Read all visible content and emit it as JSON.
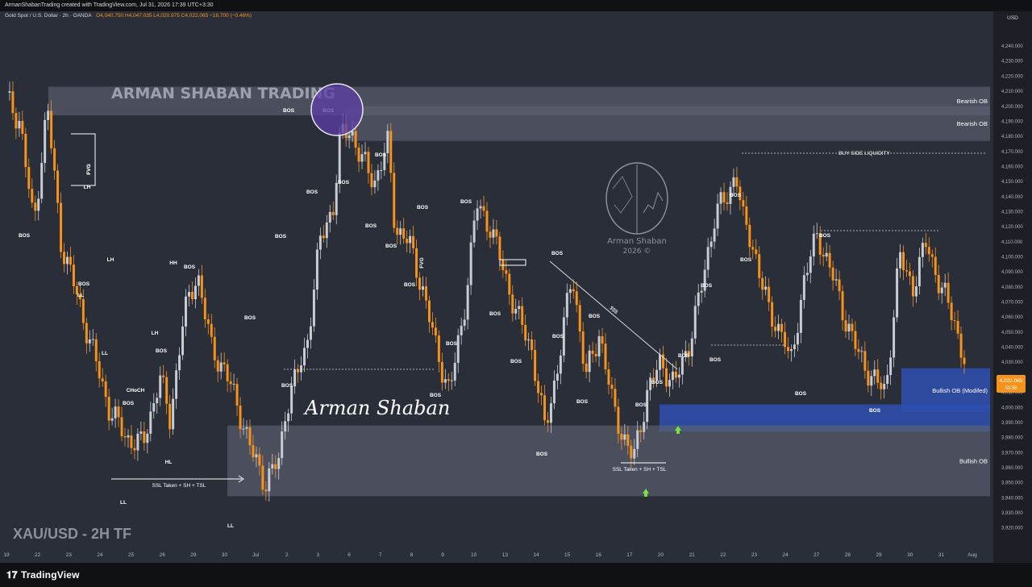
{
  "header": {
    "credit": "ArmanShabanTrading created with TradingView.com, Jul 31, 2026 17:39 UTC+3:30",
    "symbol": "Gold Spot / U.S. Dollar · 2h · OANDA",
    "ohlc": "O4,040.750  H4,047.035  L4,020.975  C4,022.065  −18.700 (−0.46%)"
  },
  "watermark": {
    "brand": "ARMAN SHABAN TRADING",
    "signature": "Arman Shaban",
    "logo_text": "Arman Shaban",
    "logo_year": "2026 ©"
  },
  "corner_label": "XAU/USD - 2H TF",
  "footer_brand": "TradingView",
  "colors": {
    "bull": "#c9ccd3",
    "bear": "#f7931a",
    "background": "#2a2e39",
    "accent_blue": "#2962ff",
    "green_arrow": "#76e33b"
  },
  "chart_data": {
    "type": "candlestick",
    "currency": "USD",
    "y_ticks": [
      3920,
      3930,
      3940,
      3950,
      3960,
      3970,
      3980,
      3990,
      4000,
      4010,
      4020,
      4030,
      4040,
      4050,
      4060,
      4070,
      4080,
      4090,
      4100,
      4110,
      4120,
      4130,
      4140,
      4150,
      4160,
      4170,
      4180,
      4190,
      4200,
      4210,
      4220,
      4230,
      4240
    ],
    "ylim": [
      3915,
      4247
    ],
    "x_ticks": [
      "19",
      "22",
      "23",
      "24",
      "25",
      "26",
      "29",
      "30",
      "Jul",
      "2",
      "3",
      "6",
      "7",
      "8",
      "9",
      "10",
      "13",
      "14",
      "15",
      "16",
      "17",
      "20",
      "21",
      "22",
      "23",
      "24",
      "27",
      "28",
      "29",
      "30",
      "31",
      "Aug"
    ],
    "last_price": "4,022.065",
    "countdown": "50:56",
    "close_path": [
      [
        0,
        4205
      ],
      [
        4,
        4190
      ],
      [
        8,
        4120
      ],
      [
        12,
        4200
      ],
      [
        16,
        4110
      ],
      [
        20,
        4080
      ],
      [
        25,
        4040
      ],
      [
        30,
        4000
      ],
      [
        35,
        3980
      ],
      [
        40,
        3975
      ],
      [
        45,
        4020
      ],
      [
        48,
        3992
      ],
      [
        52,
        4060
      ],
      [
        56,
        4090
      ],
      [
        60,
        4040
      ],
      [
        64,
        4025
      ],
      [
        68,
        4000
      ],
      [
        72,
        3970
      ],
      [
        76,
        3950
      ],
      [
        80,
        3965
      ],
      [
        82,
        4000
      ],
      [
        85,
        4020
      ],
      [
        88,
        4040
      ],
      [
        92,
        4110
      ],
      [
        96,
        4135
      ],
      [
        98,
        4180
      ],
      [
        101,
        4185
      ],
      [
        104,
        4165
      ],
      [
        108,
        4150
      ],
      [
        112,
        4175
      ],
      [
        114,
        4120
      ],
      [
        118,
        4110
      ],
      [
        122,
        4080
      ],
      [
        126,
        4040
      ],
      [
        130,
        4010
      ],
      [
        134,
        4060
      ],
      [
        138,
        4135
      ],
      [
        142,
        4120
      ],
      [
        146,
        4090
      ],
      [
        150,
        4060
      ],
      [
        154,
        4040
      ],
      [
        158,
        3985
      ],
      [
        162,
        4030
      ],
      [
        166,
        4090
      ],
      [
        170,
        4020
      ],
      [
        174,
        4050
      ],
      [
        178,
        4000
      ],
      [
        182,
        3975
      ],
      [
        184,
        3965
      ],
      [
        188,
        4010
      ],
      [
        192,
        4030
      ],
      [
        196,
        4015
      ],
      [
        200,
        4040
      ],
      [
        204,
        4080
      ],
      [
        208,
        4130
      ],
      [
        212,
        4140
      ],
      [
        214,
        4160
      ],
      [
        216,
        4125
      ],
      [
        220,
        4100
      ],
      [
        224,
        4060
      ],
      [
        228,
        4050
      ],
      [
        230,
        4025
      ],
      [
        234,
        4085
      ],
      [
        238,
        4115
      ],
      [
        242,
        4090
      ],
      [
        246,
        4060
      ],
      [
        250,
        4035
      ],
      [
        254,
        4020
      ],
      [
        258,
        4010
      ],
      [
        262,
        4100
      ],
      [
        266,
        4080
      ],
      [
        270,
        4110
      ],
      [
        274,
        4080
      ],
      [
        278,
        4060
      ],
      [
        280,
        4040
      ],
      [
        282,
        4022
      ]
    ],
    "zones": [
      {
        "label": "Bearish OB",
        "from": 4194,
        "to": 4213,
        "color": "gray"
      },
      {
        "label": "Bearish OB",
        "from": 4177,
        "to": 4200,
        "color": "gray"
      },
      {
        "label": "Bullish OB (Modifed)",
        "from": 3997,
        "to": 4026,
        "color": "blue"
      },
      {
        "label": "",
        "from": 3984,
        "to": 4002,
        "color": "blue"
      },
      {
        "label": "Bullish OB",
        "from": 3941,
        "to": 3988,
        "color": "gray"
      }
    ],
    "annotations": [
      {
        "text": "BUY SIDE LIQUIDITY",
        "price": 4166
      },
      {
        "text": "SSL Taken + SH + TSL",
        "price": 3962
      },
      {
        "text": "SSL Taken + SH + TSL",
        "price": 3966
      },
      {
        "text": "$$$",
        "price": 4070
      },
      {
        "text": "BOS"
      },
      {
        "text": "LH"
      },
      {
        "text": "LL"
      },
      {
        "text": "HH"
      },
      {
        "text": "HL"
      },
      {
        "text": "CHoCH"
      },
      {
        "text": "FVG"
      }
    ],
    "structure_labels": [
      {
        "t": "BOS",
        "x": 30,
        "y": 280
      },
      {
        "t": "LL",
        "x": 100,
        "y": 354
      },
      {
        "t": "BOS",
        "x": 104,
        "y": 340
      },
      {
        "t": "LH",
        "x": 108,
        "y": 220
      },
      {
        "t": "FVG",
        "x": 112,
        "y": 196
      },
      {
        "t": "LH",
        "x": 137,
        "y": 310
      },
      {
        "t": "LL",
        "x": 130,
        "y": 426
      },
      {
        "t": "LH",
        "x": 192,
        "y": 401
      },
      {
        "t": "BOS",
        "x": 200,
        "y": 423
      },
      {
        "t": "CHoCH",
        "x": 168,
        "y": 472
      },
      {
        "t": "BOS",
        "x": 159,
        "y": 488
      },
      {
        "t": "HH",
        "x": 215,
        "y": 314
      },
      {
        "t": "BOS",
        "x": 235,
        "y": 319
      },
      {
        "t": "HL",
        "x": 209,
        "y": 561
      },
      {
        "t": "LL",
        "x": 153,
        "y": 611
      },
      {
        "t": "LL",
        "x": 286,
        "y": 640
      },
      {
        "t": "BOS",
        "x": 310,
        "y": 382
      },
      {
        "t": "BOS",
        "x": 356,
        "y": 466
      },
      {
        "t": "BOS",
        "x": 348,
        "y": 281
      },
      {
        "t": "BOS",
        "x": 387,
        "y": 226
      },
      {
        "t": "BOS",
        "x": 407,
        "y": 125
      },
      {
        "t": "BOS",
        "x": 358,
        "y": 125
      },
      {
        "t": "BOS",
        "x": 426,
        "y": 214
      },
      {
        "t": "BOS",
        "x": 472,
        "y": 180
      },
      {
        "t": "BOS",
        "x": 460,
        "y": 268
      },
      {
        "t": "BOS",
        "x": 485,
        "y": 293
      },
      {
        "t": "BOS",
        "x": 524,
        "y": 245
      },
      {
        "t": "FVG",
        "x": 525,
        "y": 312
      },
      {
        "t": "BOS",
        "x": 508,
        "y": 341
      },
      {
        "t": "BOS",
        "x": 540,
        "y": 478
      },
      {
        "t": "BOS",
        "x": 578,
        "y": 238
      },
      {
        "t": "BOS",
        "x": 560,
        "y": 414
      },
      {
        "t": "BOS",
        "x": 614,
        "y": 377
      },
      {
        "t": "BOS",
        "x": 640,
        "y": 436
      },
      {
        "t": "BOS",
        "x": 691,
        "y": 302
      },
      {
        "t": "BOS",
        "x": 692,
        "y": 405
      },
      {
        "t": "BOS",
        "x": 722,
        "y": 486
      },
      {
        "t": "BOS",
        "x": 737,
        "y": 380
      },
      {
        "t": "BOS",
        "x": 672,
        "y": 551
      },
      {
        "t": "BOS",
        "x": 795,
        "y": 490
      },
      {
        "t": "BOS",
        "x": 815,
        "y": 462
      },
      {
        "t": "BOS",
        "x": 848,
        "y": 429
      },
      {
        "t": "BOS",
        "x": 876,
        "y": 342
      },
      {
        "t": "BOS",
        "x": 887,
        "y": 434
      },
      {
        "t": "BOS",
        "x": 912,
        "y": 230
      },
      {
        "t": "BOS",
        "x": 925,
        "y": 310
      },
      {
        "t": "BOS",
        "x": 993,
        "y": 476
      },
      {
        "t": "BOS",
        "x": 1023,
        "y": 280
      },
      {
        "t": "BOS",
        "x": 1085,
        "y": 497
      },
      {
        "t": "FVG",
        "x": 112,
        "y": 196
      }
    ]
  }
}
